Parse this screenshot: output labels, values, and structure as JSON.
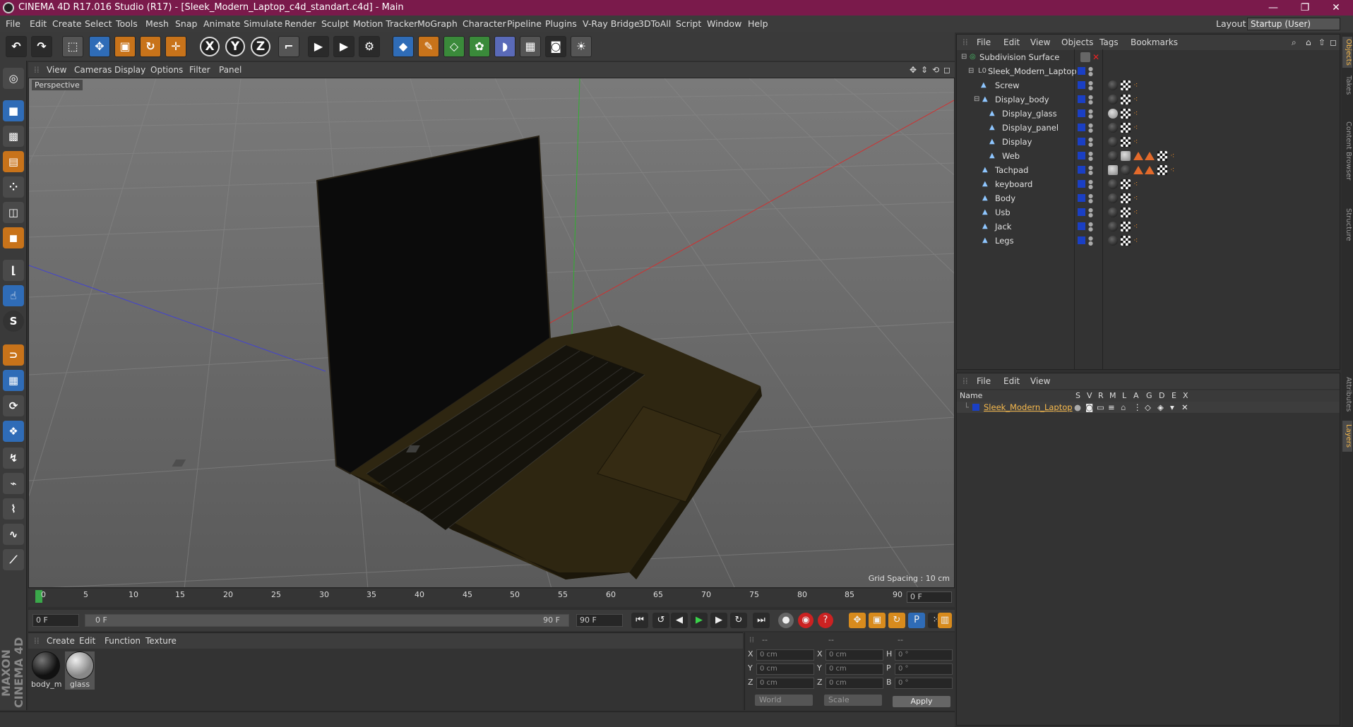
{
  "window": {
    "title": "CINEMA 4D R17.016 Studio (R17) - [Sleek_Modern_Laptop_c4d_standart.c4d] - Main",
    "minimize": "—",
    "maximize": "❐",
    "close": "✕"
  },
  "menu": {
    "items": [
      "File",
      "Edit",
      "Create",
      "Select",
      "Tools",
      "Mesh",
      "Snap",
      "Animate",
      "Simulate",
      "Render",
      "Sculpt",
      "Motion Tracker",
      "MoGraph",
      "Character",
      "Pipeline",
      "Plugins",
      "V-Ray Bridge",
      "3DToAll",
      "Script",
      "Window",
      "Help"
    ],
    "layout_label": "Layout:",
    "layout_value": "Startup (User)"
  },
  "toolbar": {
    "undo_icon": "undo-icon",
    "axes": [
      "X",
      "Y",
      "Z"
    ]
  },
  "viewport": {
    "menu": [
      "View",
      "Cameras",
      "Display",
      "Options",
      "Filter",
      "Panel"
    ],
    "camera_label": "Perspective",
    "grid_spacing": "Grid Spacing : 10 cm"
  },
  "timeline": {
    "ticks": [
      "0",
      "5",
      "10",
      "15",
      "20",
      "25",
      "30",
      "35",
      "40",
      "45",
      "50",
      "55",
      "60",
      "65",
      "70",
      "75",
      "80",
      "85",
      "90"
    ],
    "current_frame": "0 F",
    "start_field": "0 F",
    "range_start": "0 F",
    "range_end": "90 F",
    "end_field": "90 F"
  },
  "materials": {
    "menu": [
      "Create",
      "Edit",
      "Function",
      "Texture"
    ],
    "items": [
      {
        "name": "body_m"
      },
      {
        "name": "glass"
      }
    ]
  },
  "coordinates": {
    "headers": [
      "--",
      "--",
      "--"
    ],
    "rows": [
      {
        "a": "X",
        "av": "0 cm",
        "b": "X",
        "bv": "0 cm",
        "c": "H",
        "cv": "0 °"
      },
      {
        "a": "Y",
        "av": "0 cm",
        "b": "Y",
        "bv": "0 cm",
        "c": "P",
        "cv": "0 °"
      },
      {
        "a": "Z",
        "av": "0 cm",
        "b": "Z",
        "bv": "0 cm",
        "c": "B",
        "cv": "0 °"
      }
    ],
    "mode": "World",
    "scale": "Scale",
    "apply": "Apply"
  },
  "objects": {
    "menu": [
      "File",
      "Edit",
      "View",
      "Objects",
      "Tags",
      "Bookmarks"
    ],
    "tree": [
      {
        "name": "Subdivision Surface",
        "level": 0
      },
      {
        "name": "Sleek_Modern_Laptop",
        "level": 1
      },
      {
        "name": "Screw",
        "level": 2
      },
      {
        "name": "Display_body",
        "level": 2
      },
      {
        "name": "Display_glass",
        "level": 3
      },
      {
        "name": "Display_panel",
        "level": 3
      },
      {
        "name": "Display",
        "level": 3
      },
      {
        "name": "Web",
        "level": 3
      },
      {
        "name": "Tachpad",
        "level": 2
      },
      {
        "name": "keyboard",
        "level": 2
      },
      {
        "name": "Body",
        "level": 2
      },
      {
        "name": "Usb",
        "level": 2
      },
      {
        "name": "Jack",
        "level": 2
      },
      {
        "name": "Legs",
        "level": 2
      }
    ]
  },
  "layers": {
    "menu": [
      "File",
      "Edit",
      "View"
    ],
    "headers": [
      "Name",
      "S",
      "V",
      "R",
      "M",
      "L",
      "A",
      "G",
      "D",
      "E",
      "X"
    ],
    "row": {
      "name": "Sleek_Modern_Laptop",
      "color": "#1a3fc4"
    }
  },
  "sidetabs": [
    "Objects",
    "Takes",
    "Content Browser",
    "Structure",
    "Attributes",
    "Layers"
  ],
  "brand": "MAXON CINEMA 4D",
  "colors": {
    "titlebar": "#7a1a4b",
    "accent_blue": "#2f6cb7",
    "accent_orange": "#c8731a",
    "layer_name": "#f6b94d"
  }
}
